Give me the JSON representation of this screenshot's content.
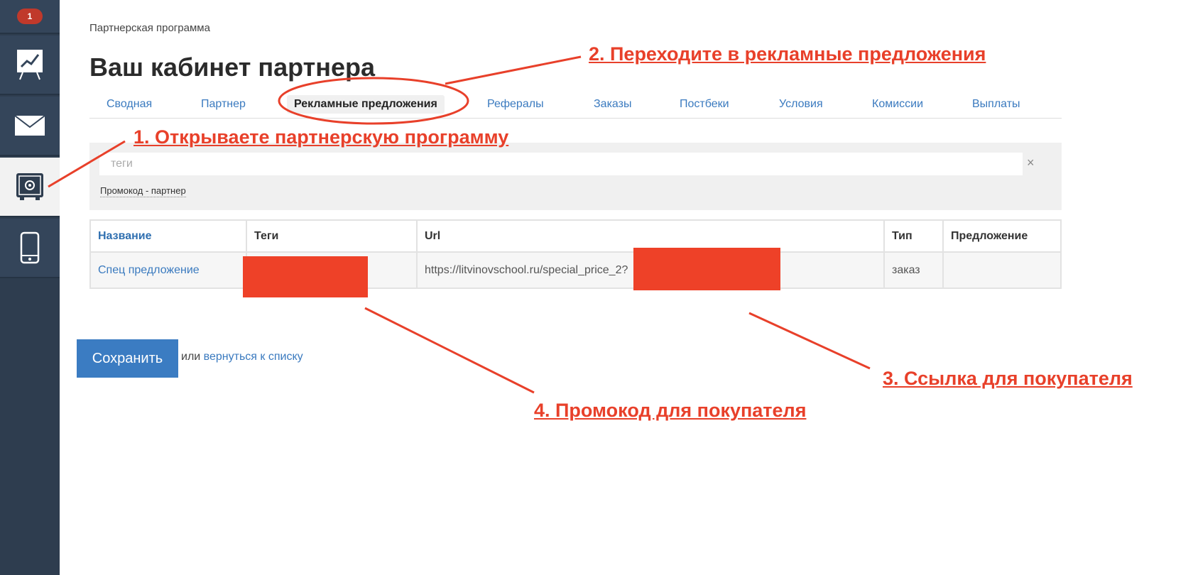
{
  "sidebar": {
    "badge": "1",
    "items": [
      {
        "icon": "chart-board-icon"
      },
      {
        "icon": "envelope-icon"
      },
      {
        "icon": "safe-icon"
      },
      {
        "icon": "phone-icon"
      }
    ]
  },
  "breadcrumb": "Партнерская программа",
  "page_title": "Ваш кабинет партнера",
  "tabs": [
    {
      "label": "Сводная"
    },
    {
      "label": "Партнер"
    },
    {
      "label": "Рекламные предложения"
    },
    {
      "label": "Рефералы"
    },
    {
      "label": "Заказы"
    },
    {
      "label": "Постбеки"
    },
    {
      "label": "Условия"
    },
    {
      "label": "Комиссии"
    },
    {
      "label": "Выплаты"
    }
  ],
  "filter": {
    "placeholder": "теги",
    "clear": "×",
    "tag": "Промокод - партнер"
  },
  "table": {
    "headers": [
      "Название",
      "Теги",
      "Url",
      "Тип",
      "Предложение"
    ],
    "rows": [
      {
        "name": "Спец предложение",
        "tags": "",
        "url": "https://litvinovschool.ru/special_price_2?",
        "type": "заказ",
        "offer": ""
      }
    ]
  },
  "actions": {
    "save": "Сохранить",
    "or": "или",
    "back": "вернуться к списку"
  },
  "annotations": {
    "step1": "1. Открываете  партнерскую программу",
    "step2": "2. Переходите  в рекламные предложения",
    "step3": "3. Ссылка для покупателя",
    "step4": "4. Промокод для покупателя"
  },
  "colors": {
    "annotation": "#e8402a",
    "link": "#3a7abf",
    "sidebar": "#2e3d4f",
    "button": "#3b7cc2"
  }
}
